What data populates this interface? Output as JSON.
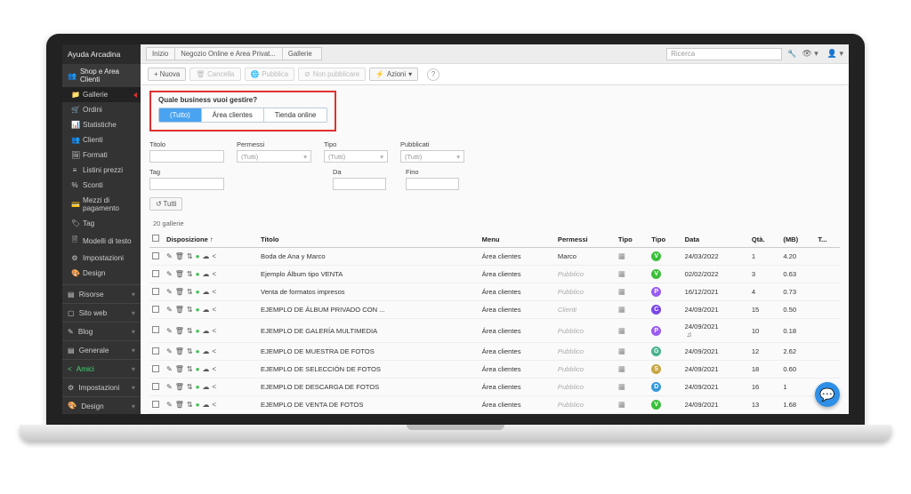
{
  "brand": "Ayuda Arcadina",
  "sidebar": {
    "group": "Shop e Area Clienti",
    "items": [
      "Gallerie",
      "Ordini",
      "Statistiche",
      "Clienti",
      "Formati",
      "Listini prezzi",
      "Sconti",
      "Mezzi di pagamento",
      "Tag",
      "Modelli di testo",
      "Impostazioni",
      "Design"
    ],
    "sections": [
      "Risorse",
      "Sito web",
      "Blog",
      "Generale",
      "Amici",
      "Impostazioni",
      "Design"
    ]
  },
  "breadcrumbs": [
    "Inizio",
    "Negozio Online e Area Privat...",
    "Gallerie"
  ],
  "search_placeholder": "Ricerca",
  "toolbar": {
    "nuova": "+ Nuova",
    "cancella": "Cancella",
    "pubblica": "Pubblica",
    "non_pubblicare": "Non pubblicare",
    "azioni": "Azioni"
  },
  "biz": {
    "title": "Quale business vuoi gestire?",
    "opts": [
      "(Tutto)",
      "Área clientes",
      "Tienda online"
    ]
  },
  "filters": {
    "titolo": "Titolo",
    "permessi": "Permessi",
    "tipo": "Tipo",
    "pubblicati": "Pubblicati",
    "permessi_v": "(Tutti)",
    "tipo_v": "(Tutti)",
    "pubblicati_v": "(Tutti)",
    "tag": "Tag",
    "da": "Da",
    "fino": "Fino",
    "tutti": "↺ Tutti"
  },
  "count": "20 gallerie",
  "headers": {
    "disp": "Disposizione ↑",
    "titolo": "Titolo",
    "menu": "Menu",
    "permessi": "Permessi",
    "tipo1": "Tipo",
    "tipo2": "Tipo",
    "data": "Data",
    "qta": "Qtà.",
    "mb": "(MB)",
    "t": "T..."
  },
  "rows": [
    {
      "titolo": "Boda de Ana y Marco",
      "menu": "Área clientes",
      "perm": "Marco",
      "perm_pub": false,
      "badge": "V",
      "bcls": "b-v",
      "data": "24/03/2022",
      "qta": "1",
      "mb": "4.20",
      "music": false
    },
    {
      "titolo": "Ejemplo Álbum tipo VENTA",
      "menu": "Área clientes",
      "perm": "Pubblico",
      "perm_pub": true,
      "badge": "V",
      "bcls": "b-v",
      "data": "02/02/2022",
      "qta": "3",
      "mb": "0.63",
      "music": false
    },
    {
      "titolo": "Venta de formatos impresos",
      "menu": "Área clientes",
      "perm": "Pubblico",
      "perm_pub": true,
      "badge": "P",
      "bcls": "b-p",
      "data": "16/12/2021",
      "qta": "4",
      "mb": "0.73",
      "music": false
    },
    {
      "titolo": "EJEMPLO DE ÁLBUM PRIVADO CON ...",
      "menu": "Área clientes",
      "perm": "Clienti",
      "perm_pub": true,
      "badge": "C",
      "bcls": "b-c",
      "data": "24/09/2021",
      "qta": "15",
      "mb": "0.50",
      "music": false
    },
    {
      "titolo": "EJEMPLO DE GALERÍA MULTIMEDIA",
      "menu": "Área clientes",
      "perm": "Pubblico",
      "perm_pub": true,
      "badge": "P",
      "bcls": "b-p",
      "data": "24/09/2021",
      "qta": "10",
      "mb": "0.18",
      "music": true
    },
    {
      "titolo": "EJEMPLO DE MUESTRA DE FOTOS",
      "menu": "Área clientes",
      "perm": "Pubblico",
      "perm_pub": true,
      "badge": "G",
      "bcls": "b-g",
      "data": "24/09/2021",
      "qta": "12",
      "mb": "2.62",
      "music": false
    },
    {
      "titolo": "EJEMPLO DE SELECCIÓN DE FOTOS",
      "menu": "Área clientes",
      "perm": "Pubblico",
      "perm_pub": true,
      "badge": "S",
      "bcls": "b-s",
      "data": "24/09/2021",
      "qta": "18",
      "mb": "0.60",
      "music": false
    },
    {
      "titolo": "EJEMPLO DE DESCARGA DE FOTOS",
      "menu": "Área clientes",
      "perm": "Pubblico",
      "perm_pub": true,
      "badge": "D",
      "bcls": "b-d",
      "data": "24/09/2021",
      "qta": "16",
      "mb": "1",
      "music": false
    },
    {
      "titolo": "EJEMPLO DE VENTA DE FOTOS",
      "menu": "Área clientes",
      "perm": "Pubblico",
      "perm_pub": true,
      "badge": "V",
      "bcls": "b-v",
      "data": "24/09/2021",
      "qta": "13",
      "mb": "1.68",
      "music": false
    }
  ]
}
